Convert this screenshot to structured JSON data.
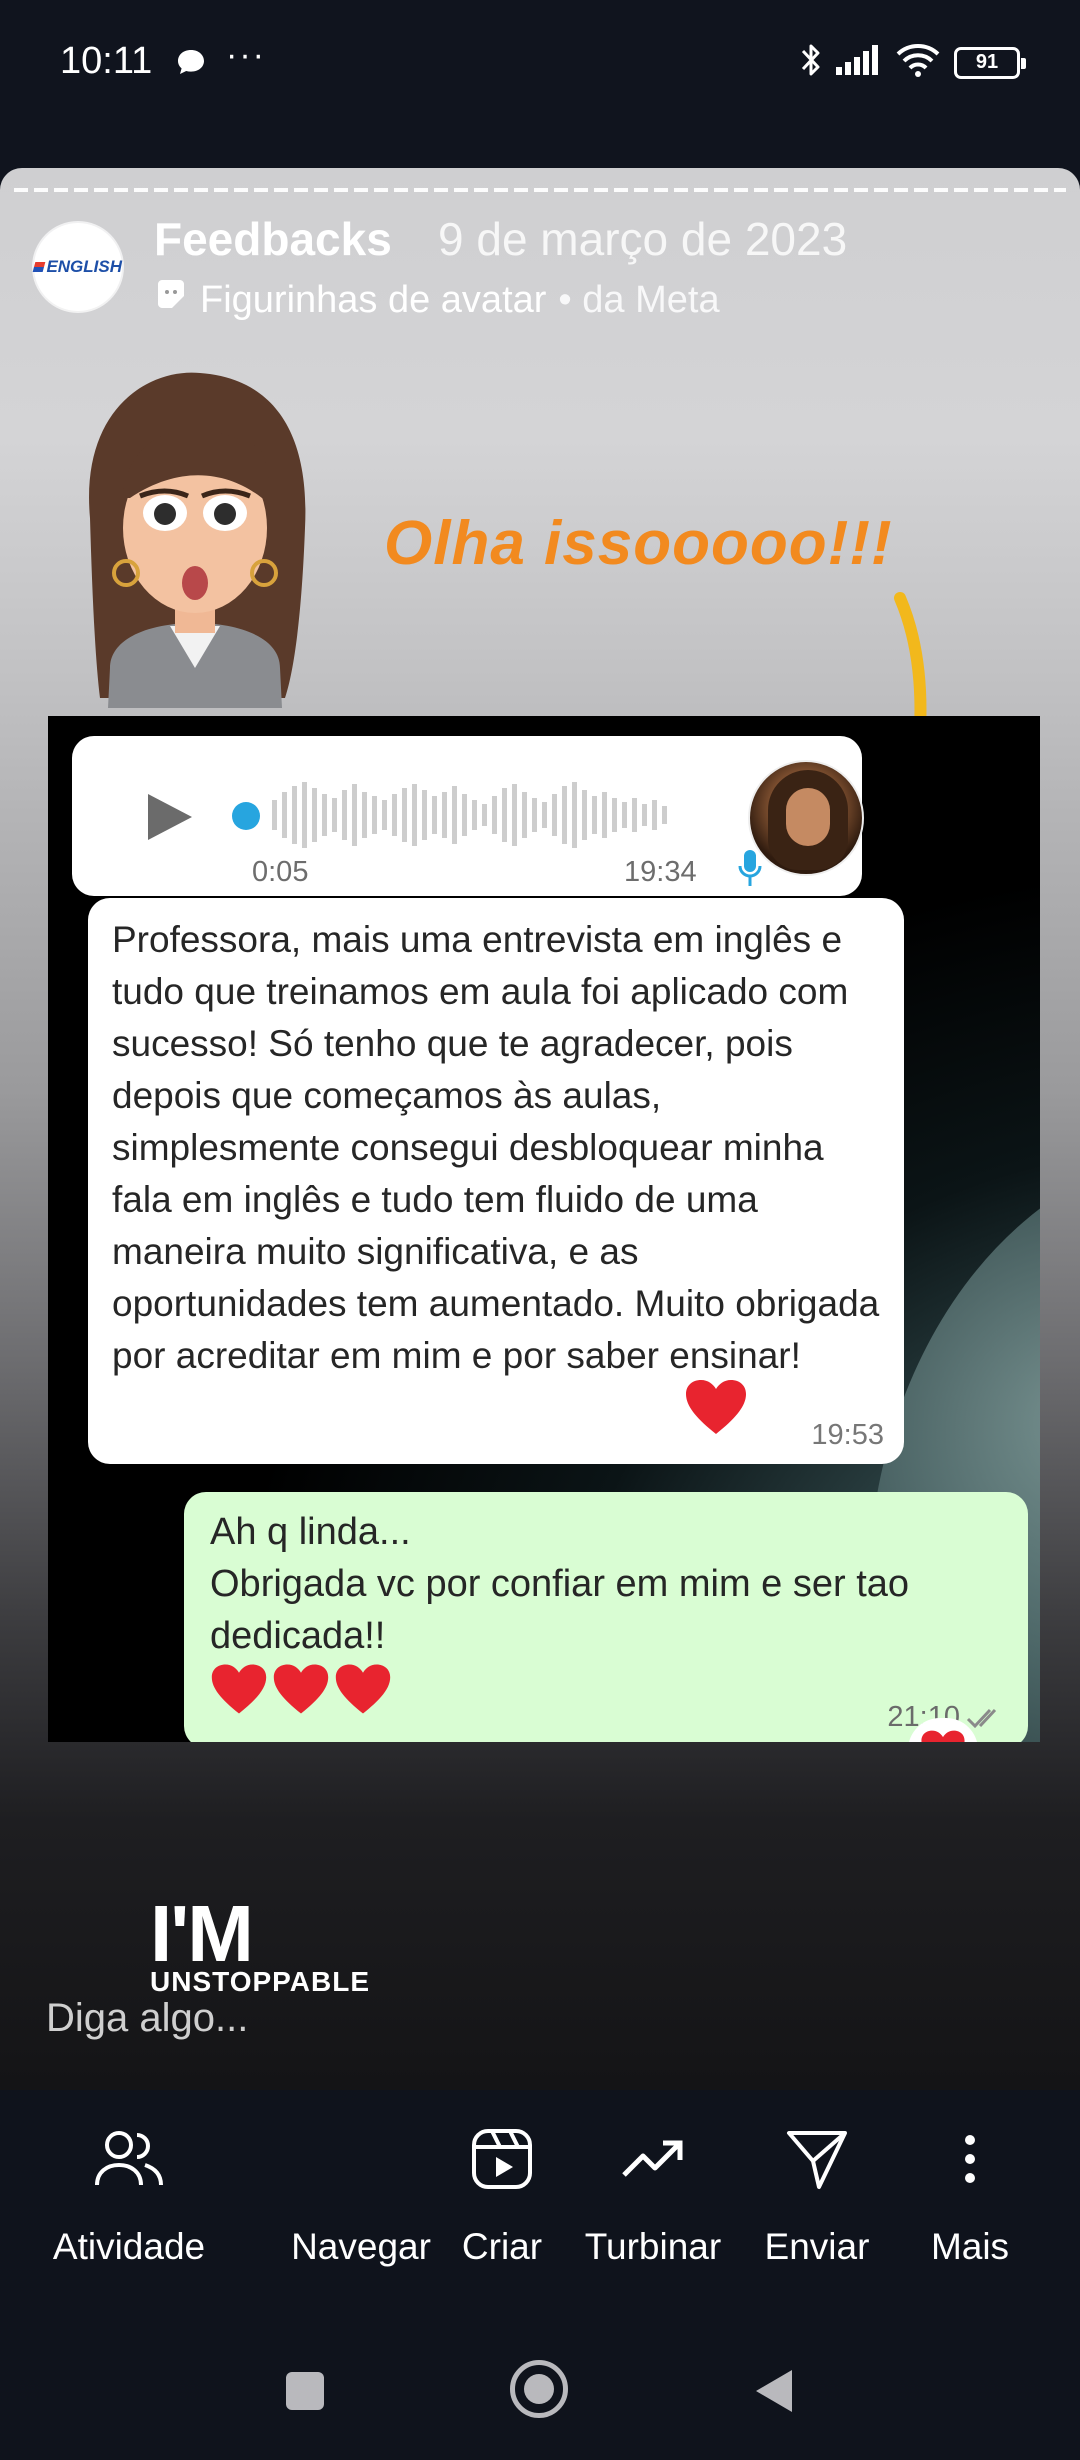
{
  "status_bar": {
    "time": "10:11",
    "dots": "···",
    "battery": "91"
  },
  "story": {
    "avatar_text": "ENGLISH",
    "user": "Feedbacks",
    "date": "9 de março de 2023",
    "sub_label": "Figurinhas de avatar",
    "sub_meta": "• da Meta",
    "overlay_text": "Olha issooooo!!!",
    "sticker_line1": "I'M",
    "sticker_line2": "UNSTOPPABLE",
    "reply_placeholder": "Diga algo..."
  },
  "chat": {
    "audio_duration": "0:05",
    "audio_time": "19:34",
    "incoming_text": "Professora, mais uma entrevista em inglês e tudo que treinamos em aula foi aplicado com sucesso! Só tenho que te agradecer, pois depois que começamos às aulas, simplesmente consegui desbloquear minha fala em inglês e tudo tem fluido de uma maneira muito significativa, e as oportunidades tem aumentado. Muito obrigada por acreditar em mim e por saber ensinar!",
    "incoming_time": "19:53",
    "outgoing_line1": "Ah q linda...",
    "outgoing_line2": "Obrigada vc por confiar em mim e ser tao dedicada!!",
    "outgoing_time": "21:10"
  },
  "actions": [
    {
      "label": "Atividade",
      "icon": "people-icon"
    },
    {
      "label": "Navegar",
      "icon": "none"
    },
    {
      "label": "Criar",
      "icon": "reels-icon"
    },
    {
      "label": "Turbinar",
      "icon": "trending-icon"
    },
    {
      "label": "Enviar",
      "icon": "send-icon"
    },
    {
      "label": "Mais",
      "icon": "more-vertical-icon"
    }
  ],
  "colors": {
    "overlay_orange": "#f28a1f",
    "arrow_yellow": "#f2b81c",
    "outgoing_bubble": "#d9fdd3",
    "heart_red": "#e8242f"
  }
}
